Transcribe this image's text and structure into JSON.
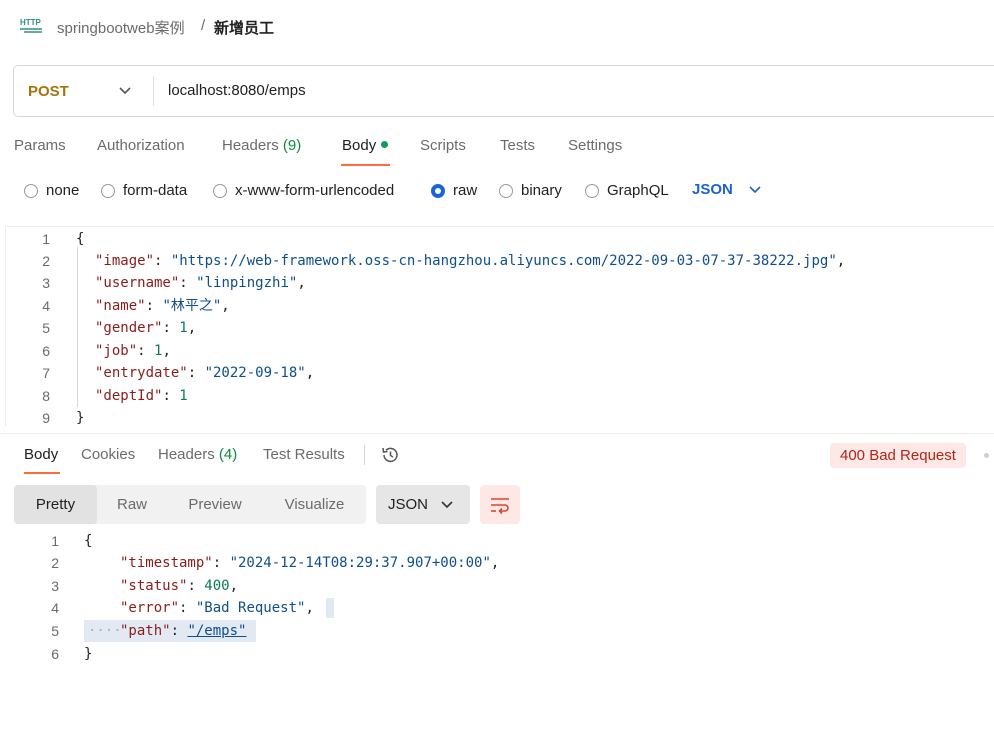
{
  "breadcrumb": {
    "icon": "http-icon",
    "icon_text": "HTTP",
    "parent": "springbootweb案例",
    "separator": "/",
    "current": "新增员工"
  },
  "request": {
    "method": "POST",
    "url": "localhost:8080/emps"
  },
  "request_tabs": [
    {
      "label": "Params"
    },
    {
      "label": "Authorization"
    },
    {
      "label": "Headers",
      "count": "(9)"
    },
    {
      "label": "Body",
      "active": true,
      "indicator": "green-dot"
    },
    {
      "label": "Scripts"
    },
    {
      "label": "Tests"
    },
    {
      "label": "Settings"
    }
  ],
  "body_types": [
    {
      "label": "none",
      "selected": false
    },
    {
      "label": "form-data",
      "selected": false
    },
    {
      "label": "x-www-form-urlencoded",
      "selected": false
    },
    {
      "label": "raw",
      "selected": true
    },
    {
      "label": "binary",
      "selected": false
    },
    {
      "label": "GraphQL",
      "selected": false
    }
  ],
  "raw_language": "JSON",
  "request_body": {
    "lines": [
      {
        "n": "1",
        "text": "{"
      },
      {
        "n": "2",
        "key": "\"image\"",
        "value": "\"https://web-framework.oss-cn-hangzhou.aliyuncs.com/2022-09-03-07-37-38222.jpg\"",
        "type": "string",
        "trail": ","
      },
      {
        "n": "3",
        "key": "\"username\"",
        "value": "\"linpingzhi\"",
        "type": "string",
        "trail": ","
      },
      {
        "n": "4",
        "key": "\"name\"",
        "value": "\"林平之\"",
        "type": "string",
        "trail": ","
      },
      {
        "n": "5",
        "key": "\"gender\"",
        "value": "1",
        "type": "number",
        "trail": ","
      },
      {
        "n": "6",
        "key": "\"job\"",
        "value": "1",
        "type": "number",
        "trail": ","
      },
      {
        "n": "7",
        "key": "\"entrydate\"",
        "value": "\"2022-09-18\"",
        "type": "string",
        "trail": ","
      },
      {
        "n": "8",
        "key": "\"deptId\"",
        "value": "1",
        "type": "number",
        "trail": ""
      },
      {
        "n": "9",
        "text": "}"
      }
    ]
  },
  "response_tabs": [
    {
      "label": "Body",
      "active": true
    },
    {
      "label": "Cookies"
    },
    {
      "label": "Headers",
      "count": "(4)"
    },
    {
      "label": "Test Results"
    }
  ],
  "status": {
    "text": "400 Bad Request",
    "color": "#b0261b",
    "background": "#fde8e6"
  },
  "response_views": [
    {
      "label": "Pretty",
      "active": true
    },
    {
      "label": "Raw"
    },
    {
      "label": "Preview"
    },
    {
      "label": "Visualize"
    }
  ],
  "response_format": "JSON",
  "response_body": {
    "lines": [
      {
        "n": "1",
        "text": "{"
      },
      {
        "n": "2",
        "key": "\"timestamp\"",
        "value": "\"2024-12-14T08:29:37.907+00:00\"",
        "type": "string",
        "trail": ","
      },
      {
        "n": "3",
        "key": "\"status\"",
        "value": "400",
        "type": "number",
        "trail": ","
      },
      {
        "n": "4",
        "key": "\"error\"",
        "value": "\"Bad Request\"",
        "type": "string",
        "trail": ","
      },
      {
        "n": "5",
        "key": "\"path\"",
        "value": "\"/emps\"",
        "type": "string",
        "trail": "",
        "highlighted": true
      },
      {
        "n": "6",
        "text": "}"
      }
    ]
  },
  "colors": {
    "accent": "#ff6c37",
    "method": "#a8730b",
    "link": "#1a63d6"
  }
}
